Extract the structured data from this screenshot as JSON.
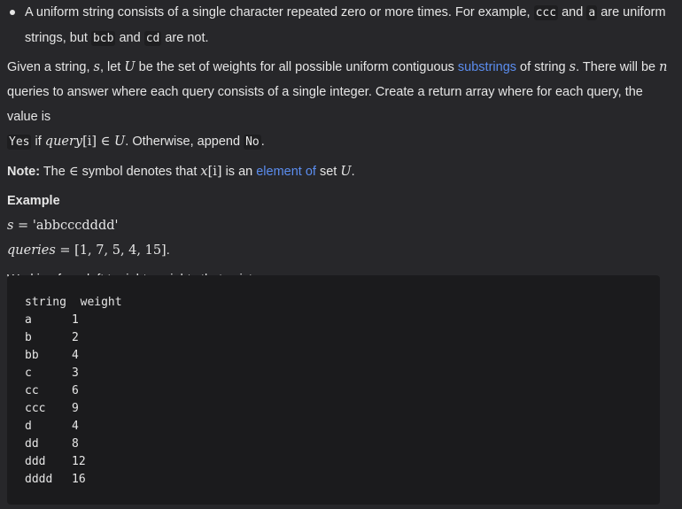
{
  "bullet": {
    "pre": "A uniform string consists of a single character repeated zero or more times. For example, ",
    "code1": "ccc",
    "mid1": " and ",
    "code2": "a",
    "mid2": " are uniform",
    "line2_pre": "strings, but ",
    "code3": "bcb",
    "mid3": " and ",
    "code4": "cd",
    "end": " are not."
  },
  "para1": {
    "t1": "Given a string, ",
    "m_s": "s",
    "t2": ", let ",
    "m_U": "U",
    "t3": " be the set of weights for all possible uniform contiguous ",
    "link_substrings": "substrings",
    "t4": " of string ",
    "m_s2": "s",
    "t5": ". There will be ",
    "m_n": "n",
    "line2": "queries to answer where each query consists of a single integer. Create a return array where for each query, the value is",
    "code_yes": "Yes",
    "t6": " if ",
    "m_query": "query",
    "m_bracket": "[i]",
    "m_in": " ∈ ",
    "m_U2": "U",
    "t7": ". Otherwise, append ",
    "code_no": "No",
    "t8": "."
  },
  "note": {
    "label": "Note:",
    "t1": " The ",
    "m_in": "∈",
    "t2": " symbol denotes that ",
    "m_x": "x",
    "m_xi": "[i]",
    "t3": " is an ",
    "link_element": "element of",
    "t4": " set ",
    "m_U": "U",
    "t5": "."
  },
  "example": {
    "heading": "Example",
    "s_var": "s",
    "s_eq": " = ",
    "s_val": "'abbcccdddd'",
    "q_var": "queries",
    "q_eq": " = ",
    "q_val": "[1, 7, 5, 4, 15]",
    "q_end": ".",
    "working": "Working from left to right, weights that exist are:"
  },
  "table": {
    "header": "string  weight",
    "rows": [
      {
        "s": "a",
        "w": "1"
      },
      {
        "s": "b",
        "w": "2"
      },
      {
        "s": "bb",
        "w": "4"
      },
      {
        "s": "c",
        "w": "3"
      },
      {
        "s": "cc",
        "w": "6"
      },
      {
        "s": "ccc",
        "w": "9"
      },
      {
        "s": "d",
        "w": "4"
      },
      {
        "s": "dd",
        "w": "8"
      },
      {
        "s": "ddd",
        "w": "12"
      },
      {
        "s": "dddd",
        "w": "16"
      }
    ]
  }
}
